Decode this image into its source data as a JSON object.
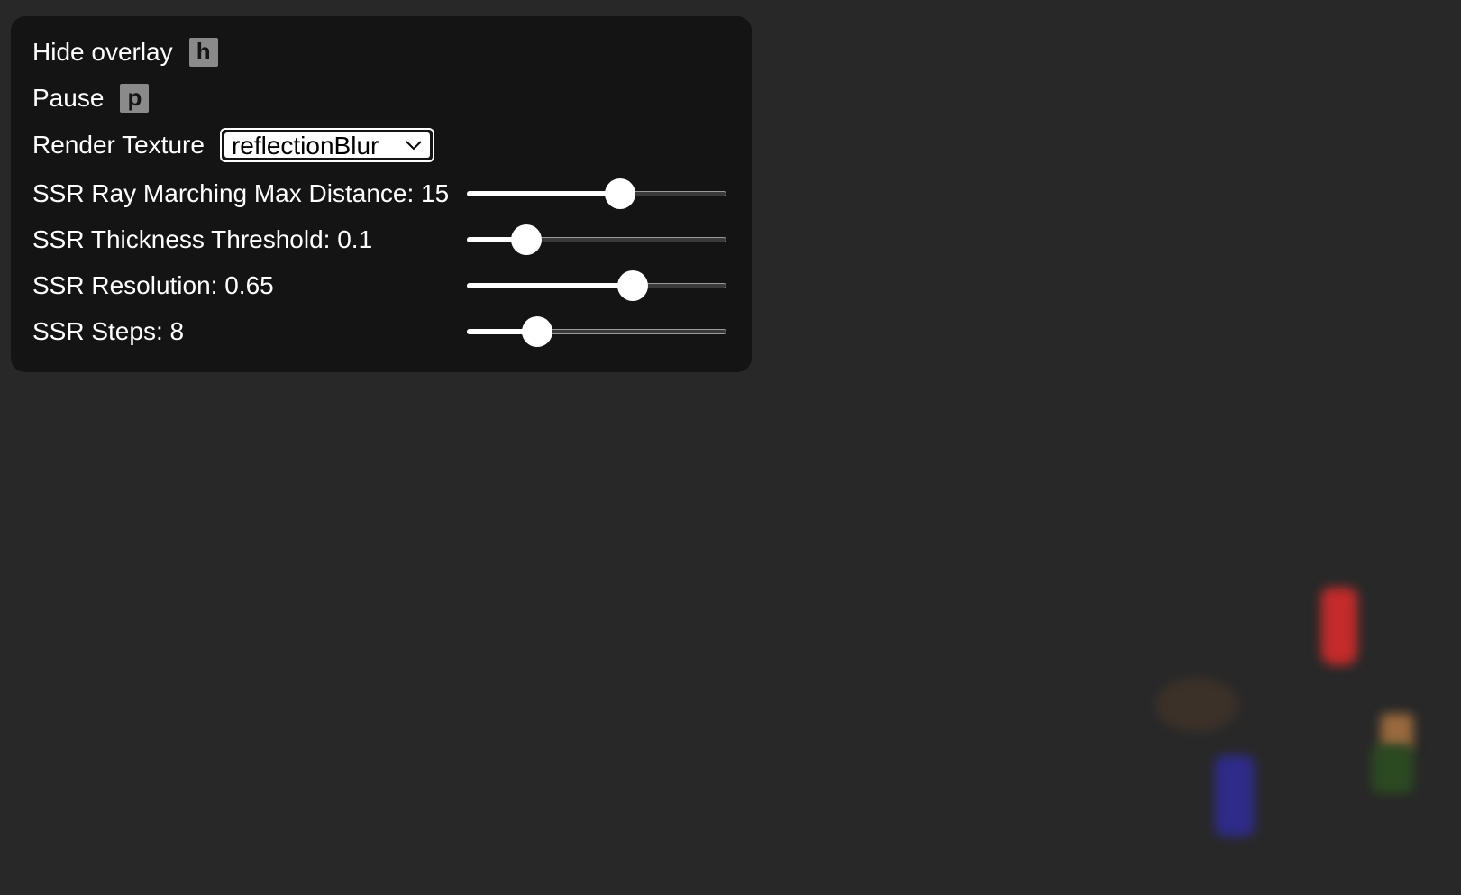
{
  "overlay": {
    "hide": {
      "label": "Hide overlay",
      "key": "h"
    },
    "pause": {
      "label": "Pause",
      "key": "p"
    },
    "render_texture": {
      "label": "Render Texture",
      "selected": "reflectionBlur"
    },
    "sliders": [
      {
        "label": "SSR Ray Marching Max Distance: 15",
        "fraction": 0.59
      },
      {
        "label": "SSR Thickness Threshold: 0.1",
        "fraction": 0.23
      },
      {
        "label": "SSR Resolution: 0.65",
        "fraction": 0.64
      },
      {
        "label": "SSR Steps: 8",
        "fraction": 0.27
      }
    ]
  },
  "colors": {
    "background": "#282828",
    "panel": "#141414",
    "red_object": "#c42b2b",
    "blue_object": "#2f2b8a",
    "green_object": "#2c4a22",
    "orange_object": "#9a6a3e",
    "brown_object": "#3a302a"
  }
}
